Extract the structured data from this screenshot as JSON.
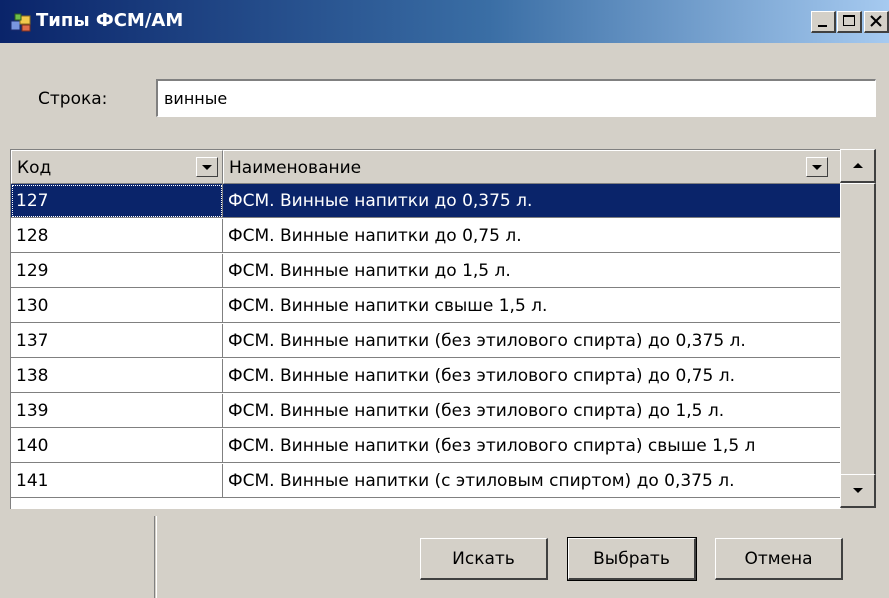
{
  "window": {
    "title": "Типы ФСМ/АМ"
  },
  "caption_buttons": {
    "minimize": "minimize-icon",
    "maximize": "maximize-icon",
    "close": "close-icon"
  },
  "search": {
    "label": "Строка:",
    "value": "винные"
  },
  "grid": {
    "columns": [
      "Код",
      "Наименование"
    ],
    "rows": [
      {
        "code": "127",
        "name": "ФСМ. Винные напитки до 0,375 л.",
        "selected": true
      },
      {
        "code": "128",
        "name": "ФСМ. Винные напитки до 0,75 л."
      },
      {
        "code": "129",
        "name": "ФСМ. Винные напитки до 1,5 л."
      },
      {
        "code": "130",
        "name": "ФСМ. Винные напитки свыше 1,5 л."
      },
      {
        "code": "137",
        "name": "ФСМ. Винные напитки (без этилового спирта) до 0,375 л."
      },
      {
        "code": "138",
        "name": "ФСМ. Винные напитки (без этилового спирта) до 0,75 л."
      },
      {
        "code": "139",
        "name": "ФСМ. Винные напитки (без этилового спирта) до 1,5 л."
      },
      {
        "code": "140",
        "name": "ФСМ. Винные напитки (без этилового спирта) свыше 1,5 л"
      },
      {
        "code": "141",
        "name": "ФСМ. Винные напитки (с этиловым спиртом) до 0,375 л."
      }
    ]
  },
  "buttons": {
    "search": "Искать",
    "select": "Выбрать",
    "cancel": "Отмена"
  },
  "colors": {
    "selection": "#0a246a",
    "face": "#d4d0c8",
    "title_start": "#0a246a",
    "title_end": "#a6caf0"
  }
}
